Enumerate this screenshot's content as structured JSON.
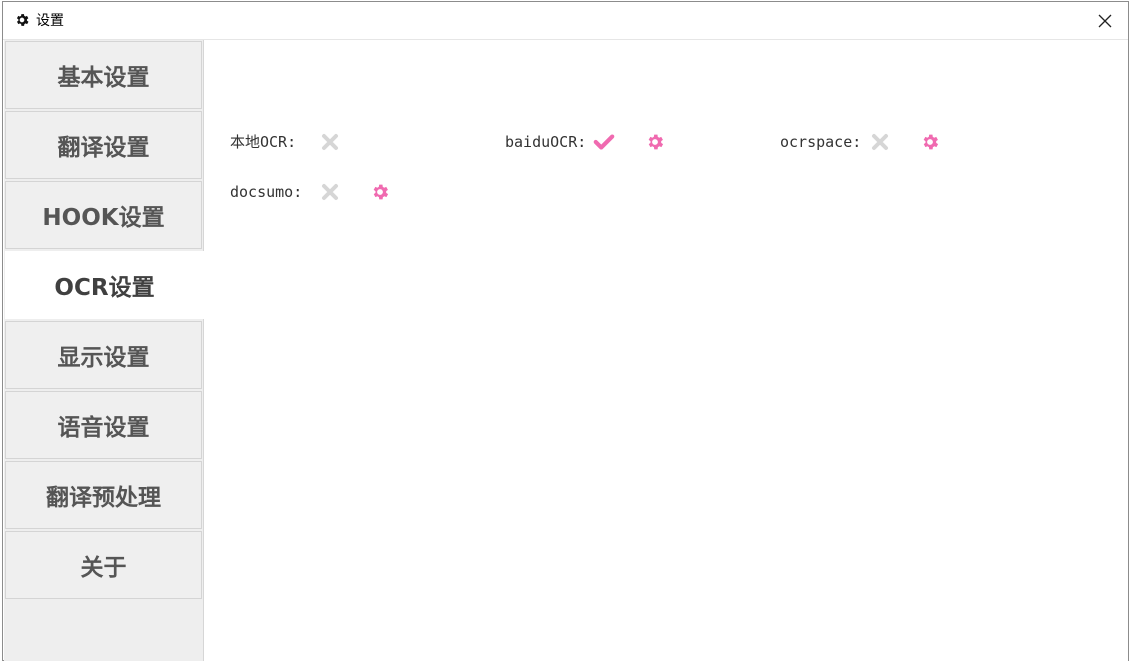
{
  "window": {
    "title": "设置"
  },
  "sidebar": {
    "items": [
      {
        "label": "基本设置",
        "active": false
      },
      {
        "label": "翻译设置",
        "active": false
      },
      {
        "label": "HOOK设置",
        "active": false
      },
      {
        "label": "OCR设置",
        "active": true
      },
      {
        "label": "显示设置",
        "active": false
      },
      {
        "label": "语音设置",
        "active": false
      },
      {
        "label": "翻译预处理",
        "active": false
      },
      {
        "label": "关于",
        "active": false
      }
    ]
  },
  "ocr": {
    "engines": [
      {
        "label": "本地OCR:",
        "enabled": false,
        "has_settings": false
      },
      {
        "label": "baiduOCR:",
        "enabled": true,
        "has_settings": true
      },
      {
        "label": "ocrspace:",
        "enabled": false,
        "has_settings": true
      },
      {
        "label": "docsumo:",
        "enabled": false,
        "has_settings": true
      }
    ]
  },
  "colors": {
    "accent": "#f06ab0",
    "disabled": "#d6d6d6"
  }
}
